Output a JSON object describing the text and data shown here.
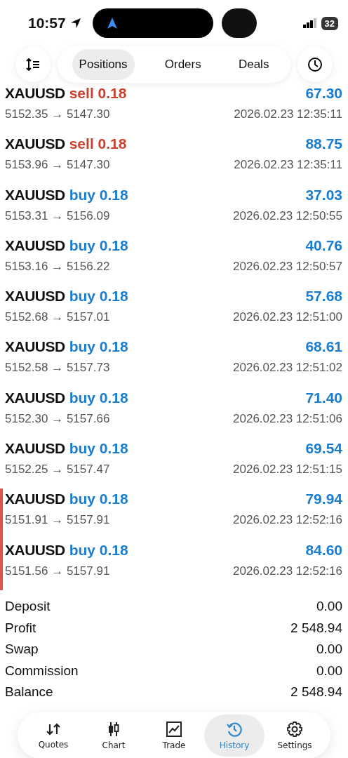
{
  "status_bar": {
    "time": "10:57",
    "battery": "32"
  },
  "tabs": [
    {
      "label": "Positions",
      "selected": true
    },
    {
      "label": "Orders",
      "selected": false
    },
    {
      "label": "Deals",
      "selected": false
    }
  ],
  "deals": [
    {
      "symbol": "XAUUSD",
      "type": "sell",
      "volume": "0.18",
      "profit": "67.30",
      "prices": "5152.35 → 5147.30",
      "time": "2026.02.23 12:35:11",
      "marked": false
    },
    {
      "symbol": "XAUUSD",
      "type": "sell",
      "volume": "0.18",
      "profit": "88.75",
      "prices": "5153.96 → 5147.30",
      "time": "2026.02.23 12:35:11",
      "marked": false
    },
    {
      "symbol": "XAUUSD",
      "type": "buy",
      "volume": "0.18",
      "profit": "37.03",
      "prices": "5153.31 → 5156.09",
      "time": "2026.02.23 12:50:55",
      "marked": false
    },
    {
      "symbol": "XAUUSD",
      "type": "buy",
      "volume": "0.18",
      "profit": "40.76",
      "prices": "5153.16 → 5156.22",
      "time": "2026.02.23 12:50:57",
      "marked": false
    },
    {
      "symbol": "XAUUSD",
      "type": "buy",
      "volume": "0.18",
      "profit": "57.68",
      "prices": "5152.68 → 5157.01",
      "time": "2026.02.23 12:51:00",
      "marked": false
    },
    {
      "symbol": "XAUUSD",
      "type": "buy",
      "volume": "0.18",
      "profit": "68.61",
      "prices": "5152.58 → 5157.73",
      "time": "2026.02.23 12:51:02",
      "marked": false
    },
    {
      "symbol": "XAUUSD",
      "type": "buy",
      "volume": "0.18",
      "profit": "71.40",
      "prices": "5152.30 → 5157.66",
      "time": "2026.02.23 12:51:06",
      "marked": false
    },
    {
      "symbol": "XAUUSD",
      "type": "buy",
      "volume": "0.18",
      "profit": "69.54",
      "prices": "5152.25 → 5157.47",
      "time": "2026.02.23 12:51:15",
      "marked": false
    },
    {
      "symbol": "XAUUSD",
      "type": "buy",
      "volume": "0.18",
      "profit": "79.94",
      "prices": "5151.91 → 5157.91",
      "time": "2026.02.23 12:52:16",
      "marked": true
    },
    {
      "symbol": "XAUUSD",
      "type": "buy",
      "volume": "0.18",
      "profit": "84.60",
      "prices": "5151.56 → 5157.91",
      "time": "2026.02.23 12:52:16",
      "marked": true
    }
  ],
  "summary": [
    {
      "label": "Deposit",
      "value": "0.00"
    },
    {
      "label": "Profit",
      "value": "2 548.94"
    },
    {
      "label": "Swap",
      "value": "0.00"
    },
    {
      "label": "Commission",
      "value": "0.00"
    },
    {
      "label": "Balance",
      "value": "2 548.94"
    }
  ],
  "nav": [
    {
      "kind": "quotes",
      "label": "Quotes",
      "selected": false
    },
    {
      "kind": "chart",
      "label": "Chart",
      "selected": false
    },
    {
      "kind": "trade",
      "label": "Trade",
      "selected": false
    },
    {
      "kind": "history",
      "label": "History",
      "selected": true
    },
    {
      "kind": "settings",
      "label": "Settings",
      "selected": false
    }
  ]
}
